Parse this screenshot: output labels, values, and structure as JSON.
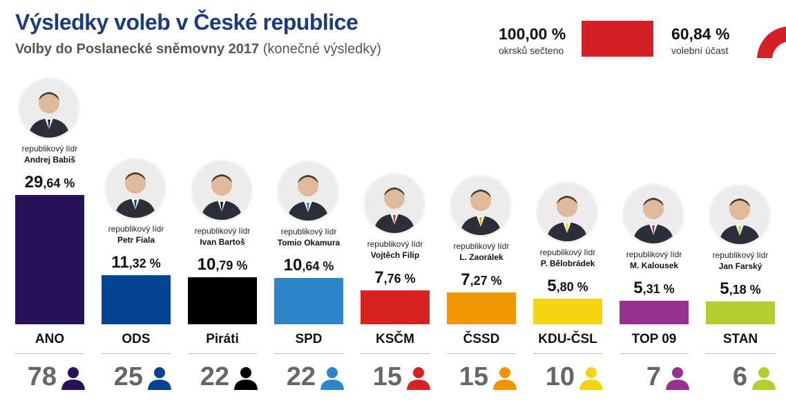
{
  "header": {
    "title": "Výsledky voleb v České republice",
    "subtitle_main": "Volby do Poslanecké sněmovny 2017",
    "subtitle_note": "(konečné výsledky)"
  },
  "stats": {
    "counted_value": "100,00 %",
    "counted_label": "okrsků sečteno",
    "counted_fraction": 1.0,
    "turnout_value": "60,84 %",
    "turnout_label": "volební účast",
    "turnout_fraction": 0.6084,
    "color": "#d62027"
  },
  "chart_data": {
    "type": "bar",
    "title": "Výsledky voleb v České republice",
    "ylabel": "",
    "ylim": [
      0,
      30
    ],
    "categories": [
      "ANO",
      "ODS",
      "Piráti",
      "SPD",
      "KSČM",
      "ČSSD",
      "KDU-ČSL",
      "TOP 09",
      "STAN"
    ],
    "values": [
      29.64,
      11.32,
      10.79,
      10.64,
      7.76,
      7.27,
      5.8,
      5.31,
      5.18
    ],
    "seats": [
      78,
      25,
      22,
      22,
      15,
      15,
      10,
      7,
      6
    ],
    "colors": [
      "#271158",
      "#034593",
      "#000000",
      "#2e86c8",
      "#d7221f",
      "#f09400",
      "#f5d511",
      "#97338f",
      "#b5cc2d"
    ]
  },
  "parties": [
    {
      "name": "ANO",
      "pct_int": "29",
      "pct_dec": ",64 %",
      "leader_role": "republikový lídr",
      "leader_name": "Andrej Babiš",
      "seats": "78",
      "color": "#271158"
    },
    {
      "name": "ODS",
      "pct_int": "11",
      "pct_dec": ",32 %",
      "leader_role": "republikový lídr",
      "leader_name": "Petr Fiala",
      "seats": "25",
      "color": "#034593"
    },
    {
      "name": "Piráti",
      "pct_int": "10",
      "pct_dec": ",79 %",
      "leader_role": "republikový lídr",
      "leader_name": "Ivan Bartoš",
      "seats": "22",
      "color": "#000000"
    },
    {
      "name": "SPD",
      "pct_int": "10",
      "pct_dec": ",64 %",
      "leader_role": "republikový lídr",
      "leader_name": "Tomio Okamura",
      "seats": "22",
      "color": "#2e86c8"
    },
    {
      "name": "KSČM",
      "pct_int": "7",
      "pct_dec": ",76 %",
      "leader_role": "republikový lídr",
      "leader_name": "Vojtěch Filip",
      "seats": "15",
      "color": "#d7221f"
    },
    {
      "name": "ČSSD",
      "pct_int": "7",
      "pct_dec": ",27 %",
      "leader_role": "republikový lídr",
      "leader_name": "L. Zaorálek",
      "seats": "15",
      "color": "#f09400"
    },
    {
      "name": "KDU-ČSL",
      "pct_int": "5",
      "pct_dec": ",80 %",
      "leader_role": "republikový lídr",
      "leader_name": "P. Bělobrádek",
      "seats": "10",
      "color": "#f5d511"
    },
    {
      "name": "TOP 09",
      "pct_int": "5",
      "pct_dec": ",31 %",
      "leader_role": "republikový lídr",
      "leader_name": "M. Kalousek",
      "seats": "7",
      "color": "#97338f"
    },
    {
      "name": "STAN",
      "pct_int": "5",
      "pct_dec": ",18 %",
      "leader_role": "republikový lídr",
      "leader_name": "Jan Farský",
      "seats": "6",
      "color": "#b5cc2d"
    }
  ]
}
